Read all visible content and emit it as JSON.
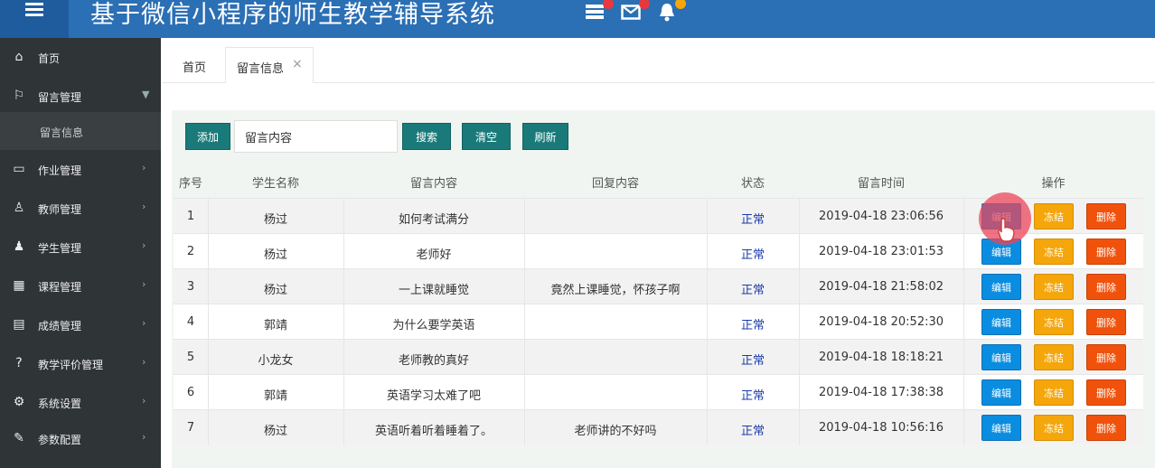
{
  "header": {
    "title": "基于微信小程序的师生教学辅导系统",
    "icons": [
      "menu-icon",
      "tasks-icon",
      "envelope-icon",
      "bell-icon"
    ],
    "colors": {
      "bar": "#2b6fb5",
      "toggle": "#1e5c9e"
    }
  },
  "sidebar": {
    "items": [
      {
        "label": "首页",
        "icon": "home-icon"
      },
      {
        "label": "留言管理",
        "icon": "flag-icon",
        "expanded": true
      },
      {
        "label": "作业管理",
        "icon": "window-icon"
      },
      {
        "label": "教师管理",
        "icon": "user-icon"
      },
      {
        "label": "学生管理",
        "icon": "users-icon"
      },
      {
        "label": "课程管理",
        "icon": "calendar-icon"
      },
      {
        "label": "成绩管理",
        "icon": "clipboard-icon"
      },
      {
        "label": "教学评价管理",
        "icon": "help-icon"
      },
      {
        "label": "系统设置",
        "icon": "gears-icon"
      },
      {
        "label": "参数配置",
        "icon": "wrench-icon"
      }
    ],
    "sub_items": [
      {
        "label": "留言信息",
        "parent": "留言管理"
      }
    ]
  },
  "tabs": [
    {
      "label": "首页",
      "active": false
    },
    {
      "label": "留言信息",
      "active": true,
      "close": "×"
    }
  ],
  "toolbar": {
    "add_label": "添加",
    "search_value": "留言内容",
    "search_label": "搜索",
    "clear_label": "清空",
    "refresh_label": "刷新"
  },
  "table": {
    "headers": [
      "序号",
      "学生名称",
      "留言内容",
      "回复内容",
      "状态",
      "留言时间",
      "操作"
    ],
    "rows": [
      {
        "no": "1",
        "student": "杨过",
        "content": "如何考试满分",
        "reply": "",
        "status": "正常",
        "time": "2019-04-18 23:06:56"
      },
      {
        "no": "2",
        "student": "杨过",
        "content": "老师好",
        "reply": "",
        "status": "正常",
        "time": "2019-04-18 23:01:53"
      },
      {
        "no": "3",
        "student": "杨过",
        "content": "一上课就睡觉",
        "reply": "竟然上课睡觉，怀孩子啊",
        "status": "正常",
        "time": "2019-04-18 21:58:02"
      },
      {
        "no": "4",
        "student": "郭靖",
        "content": "为什么要学英语",
        "reply": "",
        "status": "正常",
        "time": "2019-04-18 20:52:30"
      },
      {
        "no": "5",
        "student": "小龙女",
        "content": "老师教的真好",
        "reply": "",
        "status": "正常",
        "time": "2019-04-18 18:18:21"
      },
      {
        "no": "6",
        "student": "郭靖",
        "content": "英语学习太难了吧",
        "reply": "",
        "status": "正常",
        "time": "2019-04-18 17:38:38"
      },
      {
        "no": "7",
        "student": "杨过",
        "content": "英语听着听着睡着了。",
        "reply": "老师讲的不好吗",
        "status": "正常",
        "time": "2019-04-18 10:56:16"
      }
    ],
    "actions": {
      "edit": "编辑",
      "freeze": "冻结",
      "delete": "删除"
    },
    "colors": {
      "edit": "#0a8de0",
      "freeze": "#f5a60a",
      "delete": "#f0520c",
      "status": "#1b3aa8"
    }
  }
}
